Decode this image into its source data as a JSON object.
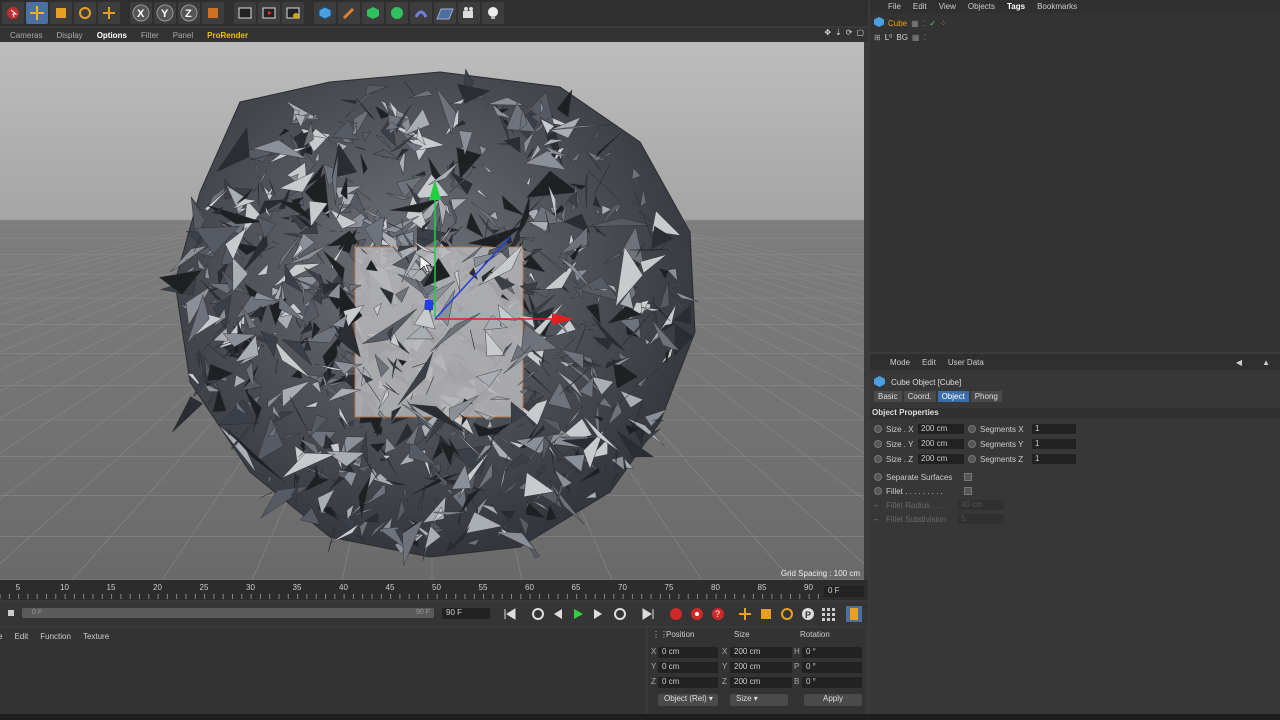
{
  "viewport_menu": {
    "items": [
      "Cameras",
      "Display",
      "Options",
      "Filter",
      "Panel",
      "ProRender"
    ],
    "selected": "Options",
    "grid_spacing": "Grid Spacing : 100 cm"
  },
  "timeline": {
    "ticks": [
      "5",
      "10",
      "15",
      "20",
      "25",
      "30",
      "35",
      "40",
      "45",
      "50",
      "55",
      "60",
      "65",
      "70",
      "75",
      "80",
      "85",
      "90"
    ],
    "current_frame": "0 F"
  },
  "transport": {
    "range_start": "0 F",
    "range_end": "90 F",
    "end_frame": "90 F"
  },
  "material_menu": [
    "File",
    "Edit",
    "Function",
    "Texture"
  ],
  "coordinates": {
    "headers": {
      "position": "Position",
      "size": "Size",
      "rotation": "Rotation"
    },
    "rows": [
      {
        "axis": "X",
        "pos": "0 cm",
        "size_axis": "X",
        "size": "200 cm",
        "rot_axis": "H",
        "rot": "0 °"
      },
      {
        "axis": "Y",
        "pos": "0 cm",
        "size_axis": "Y",
        "size": "200 cm",
        "rot_axis": "P",
        "rot": "0 °"
      },
      {
        "axis": "Z",
        "pos": "0 cm",
        "size_axis": "Z",
        "size": "200 cm",
        "rot_axis": "B",
        "rot": "0 °"
      }
    ],
    "mode_dropdown": "Object (Rel)",
    "size_dropdown": "Size",
    "apply": "Apply"
  },
  "object_manager": {
    "menu": [
      "File",
      "Edit",
      "View",
      "Objects",
      "Tags",
      "Bookmarks"
    ],
    "selected_menu": "Tags",
    "objects": [
      {
        "name": "Cube",
        "selected": true
      },
      {
        "name": "BG",
        "selected": false
      }
    ]
  },
  "attribute_manager": {
    "menu": [
      "Mode",
      "Edit",
      "User Data"
    ],
    "title": "Cube Object [Cube]",
    "tabs": [
      "Basic",
      "Coord.",
      "Object",
      "Phong"
    ],
    "selected_tab": "Object",
    "section": "Object Properties",
    "size_rows": [
      {
        "label": "Size . X",
        "value": "200 cm",
        "seg_label": "Segments X",
        "seg_value": "1"
      },
      {
        "label": "Size . Y",
        "value": "200 cm",
        "seg_label": "Segments Y",
        "seg_value": "1"
      },
      {
        "label": "Size . Z",
        "value": "200 cm",
        "seg_label": "Segments Z",
        "seg_value": "1"
      }
    ],
    "separate_surfaces": "Separate Surfaces",
    "fillet": "Fillet . . . . . . . . .",
    "fillet_radius": "Fillet Radius . . . .",
    "fillet_radius_value": "40 cm",
    "fillet_subdivision": "Fillet Subdivision",
    "fillet_subdivision_value": "5"
  },
  "colors": {
    "accent_orange": "#f0a000",
    "tab_selected": "#3a6ea8",
    "axis_x": "#e02020",
    "axis_y": "#20d040",
    "axis_z": "#2040e0"
  }
}
